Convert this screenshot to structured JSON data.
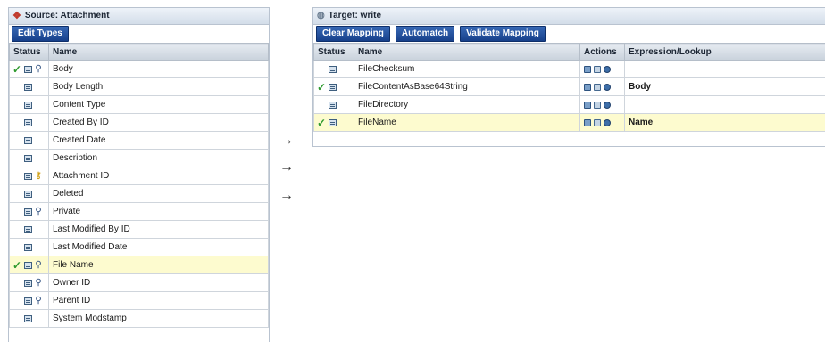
{
  "source": {
    "title": "Source: Attachment",
    "edit_types_label": "Edit Types",
    "columns": {
      "status": "Status",
      "name": "Name"
    },
    "rows": [
      {
        "name": "Body",
        "mapped": true,
        "key": false,
        "ref": true,
        "highlight": false
      },
      {
        "name": "Body Length",
        "mapped": false,
        "key": false,
        "ref": false,
        "highlight": false
      },
      {
        "name": "Content Type",
        "mapped": false,
        "key": false,
        "ref": false,
        "highlight": false
      },
      {
        "name": "Created By ID",
        "mapped": false,
        "key": false,
        "ref": false,
        "highlight": false
      },
      {
        "name": "Created Date",
        "mapped": false,
        "key": false,
        "ref": false,
        "highlight": false
      },
      {
        "name": "Description",
        "mapped": false,
        "key": false,
        "ref": false,
        "highlight": false
      },
      {
        "name": "Attachment ID",
        "mapped": false,
        "key": true,
        "ref": false,
        "highlight": false
      },
      {
        "name": "Deleted",
        "mapped": false,
        "key": false,
        "ref": false,
        "highlight": false
      },
      {
        "name": "Private",
        "mapped": false,
        "key": false,
        "ref": true,
        "highlight": false
      },
      {
        "name": "Last Modified By ID",
        "mapped": false,
        "key": false,
        "ref": false,
        "highlight": false
      },
      {
        "name": "Last Modified Date",
        "mapped": false,
        "key": false,
        "ref": false,
        "highlight": false
      },
      {
        "name": "File Name",
        "mapped": true,
        "key": false,
        "ref": true,
        "highlight": true
      },
      {
        "name": "Owner ID",
        "mapped": false,
        "key": false,
        "ref": true,
        "highlight": false
      },
      {
        "name": "Parent ID",
        "mapped": false,
        "key": false,
        "ref": true,
        "highlight": false
      },
      {
        "name": "System Modstamp",
        "mapped": false,
        "key": false,
        "ref": false,
        "highlight": false
      }
    ]
  },
  "target": {
    "title": "Target: write",
    "buttons": {
      "clear": "Clear Mapping",
      "automatch": "Automatch",
      "validate": "Validate Mapping"
    },
    "columns": {
      "status": "Status",
      "name": "Name",
      "actions": "Actions",
      "expression": "Expression/Lookup"
    },
    "rows": [
      {
        "name": "FileChecksum",
        "mapped": false,
        "expression": "",
        "highlight": false
      },
      {
        "name": "FileContentAsBase64String",
        "mapped": true,
        "expression": "Body",
        "highlight": false
      },
      {
        "name": "FileDirectory",
        "mapped": false,
        "expression": "",
        "highlight": false
      },
      {
        "name": "FileName",
        "mapped": true,
        "expression": "Name",
        "highlight": true
      }
    ]
  },
  "arrows": [
    "→",
    "→",
    "→"
  ],
  "colors": {
    "button": "#1f4a94",
    "highlight": "#fdfbcf",
    "check": "#2e9a2e",
    "header": "#d3dde9"
  },
  "icons": {
    "source_title": "source-object-icon",
    "target_title": "target-object-icon"
  }
}
